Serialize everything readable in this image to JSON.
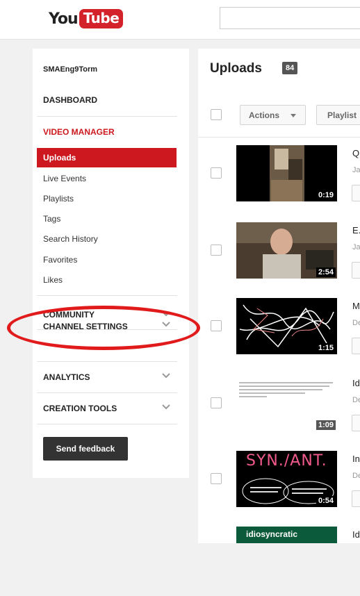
{
  "header": {
    "logo_you": "You",
    "logo_tube": "Tube",
    "search_placeholder": ""
  },
  "sidebar": {
    "username": "SMAEng9Torm",
    "dashboard": "DASHBOARD",
    "video_manager": "VIDEO MANAGER",
    "items": [
      "Uploads",
      "Live Events",
      "Playlists",
      "Tags",
      "Search History",
      "Favorites",
      "Likes"
    ],
    "sections": [
      "COMMUNITY",
      "CHANNEL SETTINGS",
      "ANALYTICS",
      "CREATION TOOLS"
    ],
    "feedback": "Send feedback"
  },
  "main": {
    "title": "Uploads",
    "count": "84",
    "actions_label": "Actions",
    "playlist_label": "Playlist",
    "videos": [
      {
        "title": "Q",
        "meta": "Ja",
        "duration": "0:19"
      },
      {
        "title": "E.",
        "meta": "Ja",
        "duration": "2:54"
      },
      {
        "title": "M",
        "meta": "De",
        "duration": "1:15"
      },
      {
        "title": "Id",
        "meta": "De",
        "duration": "1:09"
      },
      {
        "title": "In",
        "meta": "De",
        "duration": "0:54",
        "thumb_text": "SYN./ANT."
      },
      {
        "title": "Id",
        "meta": "",
        "duration": "",
        "thumb_text": "idiosyncratic"
      }
    ]
  },
  "colors": {
    "accent_red": "#cc181e",
    "annotation_red": "#e11b1b",
    "feedback_bg": "#333333"
  }
}
